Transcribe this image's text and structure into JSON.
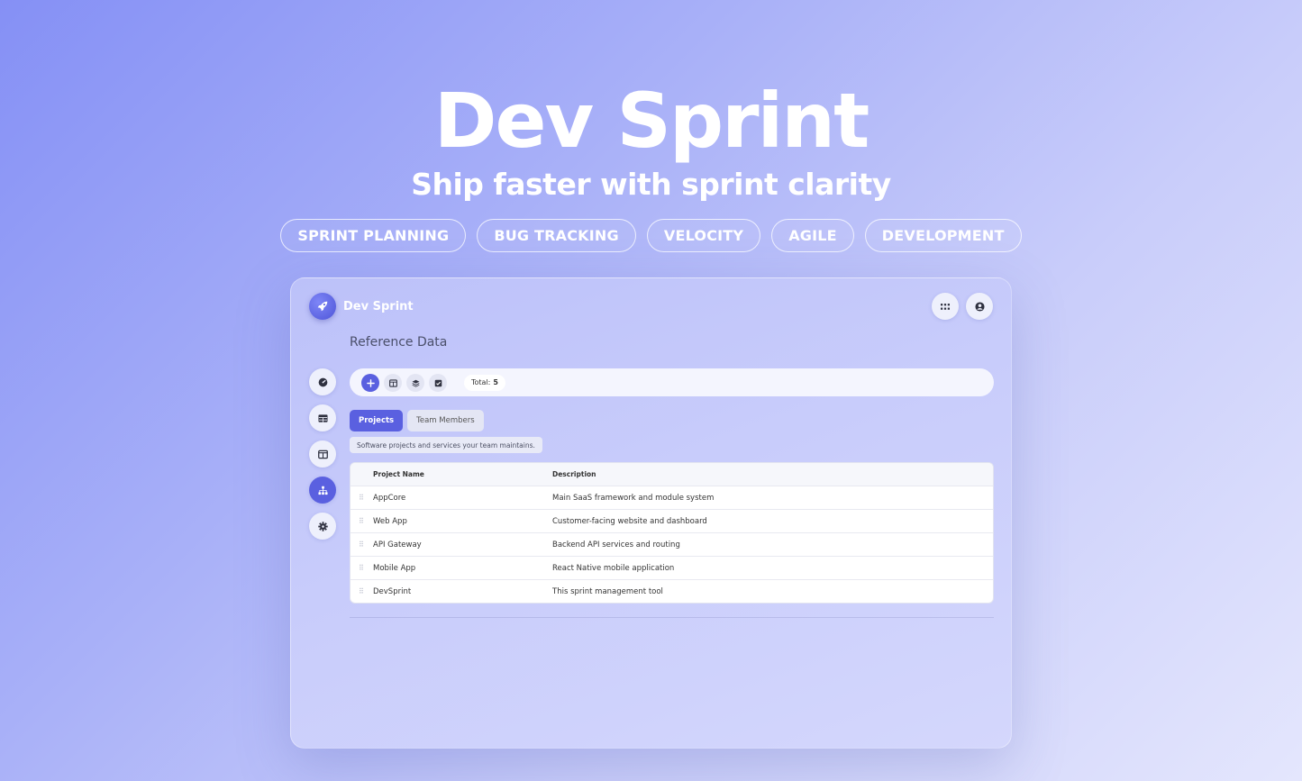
{
  "hero": {
    "title": "Dev Sprint",
    "subtitle": "Ship faster with sprint clarity",
    "tags": [
      "SPRINT PLANNING",
      "BUG TRACKING",
      "VELOCITY",
      "AGILE",
      "DEVELOPMENT"
    ]
  },
  "app": {
    "brand": {
      "name": "Dev Sprint",
      "icon": "rocket-icon"
    },
    "top_actions": [
      {
        "icon": "apps-grid-icon"
      },
      {
        "icon": "user-circle-icon"
      }
    ],
    "page_title": "Reference Data",
    "sidebar": [
      {
        "icon": "dashboard-gauge-icon",
        "active": false
      },
      {
        "icon": "table-icon",
        "active": false
      },
      {
        "icon": "columns-icon",
        "active": false
      },
      {
        "icon": "hierarchy-icon",
        "active": true
      },
      {
        "icon": "settings-gear-icon",
        "active": false
      }
    ],
    "toolbar": {
      "buttons": [
        "plus-icon",
        "columns-icon",
        "layers-icon",
        "checkbox-icon"
      ],
      "total_label": "Total:",
      "total_value": "5"
    },
    "tabs": [
      {
        "label": "Projects",
        "active": true
      },
      {
        "label": "Team Members",
        "active": false
      }
    ],
    "hint": "Software projects and services your team maintains.",
    "table": {
      "columns": [
        "Project Name",
        "Description"
      ],
      "rows": [
        {
          "name": "AppCore",
          "description": "Main SaaS framework and module system"
        },
        {
          "name": "Web App",
          "description": "Customer-facing website and dashboard"
        },
        {
          "name": "API Gateway",
          "description": "Backend API services and routing"
        },
        {
          "name": "Mobile App",
          "description": "React Native mobile application"
        },
        {
          "name": "DevSprint",
          "description": "This sprint management tool"
        }
      ]
    }
  },
  "colors": {
    "accent": "#5a60e0",
    "background_start": "#8590f5",
    "background_end": "#e4e6fd"
  }
}
